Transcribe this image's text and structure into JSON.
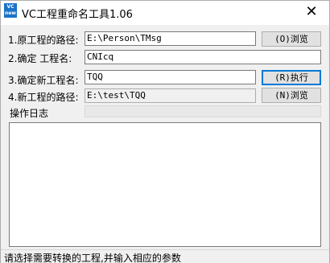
{
  "window": {
    "title": "VC工程重命名工具1.06",
    "app_icon_text": "VC new",
    "close_glyph": "✕"
  },
  "form": {
    "source_path": {
      "label": "1.原工程的路径:",
      "value": "E:\\Person\\TMsg",
      "button": "(O)浏览"
    },
    "confirm_project": {
      "label": "2.确定  工程名:",
      "value": "CNIcq"
    },
    "new_project": {
      "label": "3.确定新工程名:",
      "value": "TQQ",
      "button": "(R)执行"
    },
    "new_path": {
      "label": "4.新工程的路径:",
      "value": "E:\\test\\TQQ",
      "button": "(N)浏览"
    }
  },
  "log": {
    "label": "操作日志",
    "content": ""
  },
  "status": {
    "text": "请选择需要转换的工程,并输入相应的参数"
  },
  "colors": {
    "window_bg": "#f0f0f0",
    "titlebar_bg": "#ffffff",
    "app_icon_bg": "#1a73c9",
    "default_button_border": "#0078d7"
  },
  "icons": {
    "app": "vc-new-app-icon",
    "close": "close-icon"
  }
}
